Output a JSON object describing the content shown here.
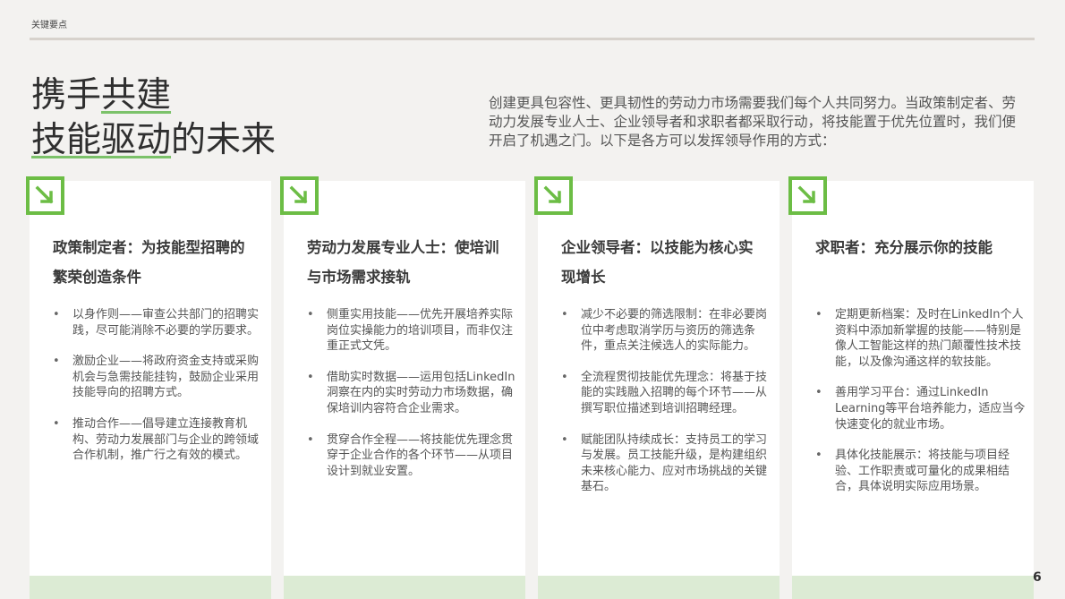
{
  "header": {
    "label": "关键要点"
  },
  "title": {
    "line1_plain": "携手",
    "line1_underlined": "共建",
    "line2_underlined": "技能驱动",
    "line2_plain": "的未来"
  },
  "intro": "创建更具包容性、更具韧性的劳动力市场需要我们每个人共同努力。当政策制定者、劳动力发展专业人士、企业领导者和求职者都采取行动，将技能置于优先位置时，我们便开启了机遇之门。以下是各方可以发挥领导作用的方式：",
  "colors": {
    "accent_green": "#6cbd45",
    "band_green": "#dcebd4",
    "background": "#f3f2f0"
  },
  "cards": [
    {
      "icon": "arrow-down-right-icon",
      "title": "政策制定者：为技能型招聘的繁荣创造条件",
      "items": [
        "以身作则——审查公共部门的招聘实践，尽可能消除不必要的学历要求。",
        "激励企业——将政府资金支持或采购机会与急需技能挂钩，鼓励企业采用技能导向的招聘方式。",
        "推动合作——倡导建立连接教育机构、劳动力发展部门与企业的跨领域合作机制，推广行之有效的模式。"
      ]
    },
    {
      "icon": "arrow-down-right-icon",
      "title": "劳动力发展专业人士：使培训与市场需求接轨",
      "items": [
        "侧重实用技能——优先开展培养实际岗位实操能力的培训项目，而非仅注重正式文凭。",
        "借助实时数据——运用包括LinkedIn洞察在内的实时劳动力市场数据，确保培训内容符合企业需求。",
        "贯穿合作全程——将技能优先理念贯穿于企业合作的各个环节——从项目设计到就业安置。"
      ]
    },
    {
      "icon": "arrow-down-right-icon",
      "title": "企业领导者：以技能为核心实现增长",
      "items": [
        "减少不必要的筛选限制：在非必要岗位中考虑取消学历与资历的筛选条件，重点关注候选人的实际能力。",
        "全流程贯彻技能优先理念：将基于技能的实践融入招聘的每个环节——从撰写职位描述到培训招聘经理。",
        "赋能团队持续成长：支持员工的学习与发展。员工技能升级，是构建组织未来核心能力、应对市场挑战的关键基石。"
      ]
    },
    {
      "icon": "arrow-down-right-icon",
      "title": "求职者：充分展示你的技能",
      "items": [
        "定期更新档案：及时在LinkedIn个人资料中添加新掌握的技能——特别是像人工智能这样的热门颠覆性技术技能，以及像沟通这样的软技能。",
        "善用学习平台：通过LinkedIn Learning等平台培养能力，适应当今快速变化的就业市场。",
        "具体化技能展示：将技能与项目经验、工作职责或可量化的成果相结合，具体说明实际应用场景。"
      ]
    }
  ],
  "page_number": "6"
}
